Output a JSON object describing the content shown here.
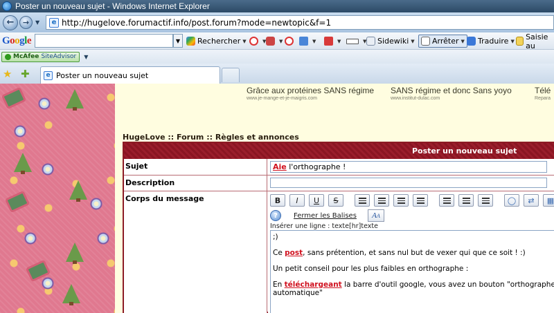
{
  "window": {
    "title": "Poster un nouveau sujet - Windows Internet Explorer"
  },
  "address_bar": {
    "url": "http://hugelove.forumactif.info/post.forum?mode=newtopic&f=1"
  },
  "google_toolbar": {
    "logo": "Google",
    "search_value": "",
    "items": {
      "rechercher": "Rechercher",
      "sidewiki": "Sidewiki",
      "arreter": "Arrêter",
      "traduire": "Traduire",
      "saisie": "Saisie au"
    }
  },
  "mcafee": {
    "brand": "McAfee",
    "product": "SiteAdvisor"
  },
  "tabs": [
    {
      "label": "Poster un nouveau sujet",
      "active": true
    }
  ],
  "ads": [
    {
      "title": "Grâce aux protéines SANS régime",
      "url": "www.je-mange-et-je-maigris.com"
    },
    {
      "title": "SANS régime et donc Sans yoyo",
      "url": "www.institut-dulac.com"
    },
    {
      "title": "Télé",
      "url": "Repara"
    }
  ],
  "breadcrumb": "HugeLove  :: Forum :: Règles et annonces",
  "form": {
    "header": "Poster un nouveau sujet",
    "subject_label": "Sujet",
    "subject_value_marked": "Aie",
    "subject_value_rest": " l'orthographe !",
    "description_label": "Description",
    "description_value": "",
    "body_label": "Corps du message",
    "close_tags_label": "Fermer les Balises",
    "hint": "Insérer une ligne : texte[hr]texte",
    "message": {
      "line1": ";)",
      "line2_pre": "Ce ",
      "line2_link": "post",
      "line2_post": ", sans prétention, et sans nul but de vexer qui que ce soit ! :)",
      "line3": "Un petit conseil pour les plus faibles en orthographe :",
      "line4_pre": "En ",
      "line4_link": "téléchargeant",
      "line4_post": " la barre d'outil google, vous avez un bouton \"orthographe\", e",
      "line5": "automatique\""
    }
  }
}
